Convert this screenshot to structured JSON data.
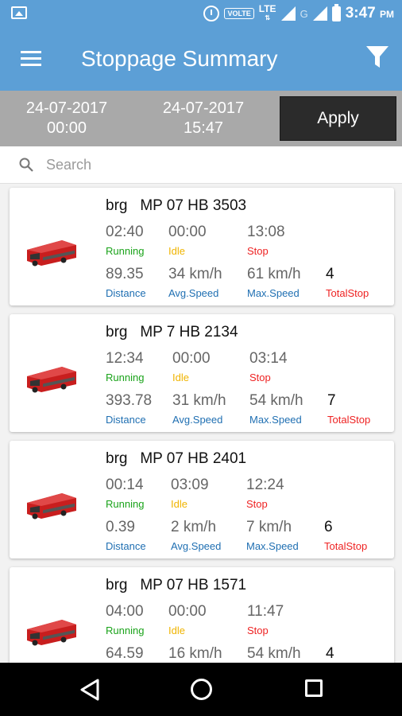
{
  "status_bar": {
    "volte": "VOLTE",
    "lte": "LTE",
    "g": "G",
    "time": "3:47",
    "ampm": "PM"
  },
  "app_bar": {
    "title": "Stoppage Summary",
    "menu_icon": "hamburger-menu-icon",
    "filter_icon": "filter-funnel-icon"
  },
  "date_range": {
    "from_date": "24-07-2017",
    "from_time": "00:00",
    "to_date": "24-07-2017",
    "to_time": "15:47",
    "apply_label": "Apply"
  },
  "search": {
    "placeholder": "Search"
  },
  "labels": {
    "running": "Running",
    "idle": "Idle",
    "stop": "Stop",
    "distance": "Distance",
    "avg_speed": "Avg.Speed",
    "max_speed": "Max.Speed",
    "total_stop": "TotalStop"
  },
  "colors": {
    "app_bar": "#5c9fd6",
    "date_bar": "#a9a9a9",
    "apply_button": "#2b2b2b",
    "running": "#1aa31a",
    "idle": "#f0b400",
    "stop": "#ee2222",
    "metric_label": "#1f6fb2"
  },
  "vehicles": [
    {
      "group": "brg",
      "number": "MP 07 HB 3503",
      "running": "02:40",
      "idle": "00:00",
      "stop": "13:08",
      "distance": "89.35",
      "avg_speed": "34 km/h",
      "max_speed": "61 km/h",
      "total_stop": "4"
    },
    {
      "group": "brg",
      "number": "MP 7 HB 2134",
      "running": "12:34",
      "idle": "00:00",
      "stop": "03:14",
      "distance": "393.78",
      "avg_speed": "31 km/h",
      "max_speed": "54 km/h",
      "total_stop": "7"
    },
    {
      "group": "brg",
      "number": "MP 07 HB 2401",
      "running": "00:14",
      "idle": "03:09",
      "stop": "12:24",
      "distance": "0.39",
      "avg_speed": "2 km/h",
      "max_speed": "7 km/h",
      "total_stop": "6"
    },
    {
      "group": "brg",
      "number": "MP 07 HB 1571",
      "running": "04:00",
      "idle": "00:00",
      "stop": "11:47",
      "distance": "64.59",
      "avg_speed": "16 km/h",
      "max_speed": "54 km/h",
      "total_stop": "4"
    }
  ],
  "nav_bar": {
    "back_icon": "back-triangle-icon",
    "home_icon": "home-circle-icon",
    "recents_icon": "recents-square-icon"
  }
}
